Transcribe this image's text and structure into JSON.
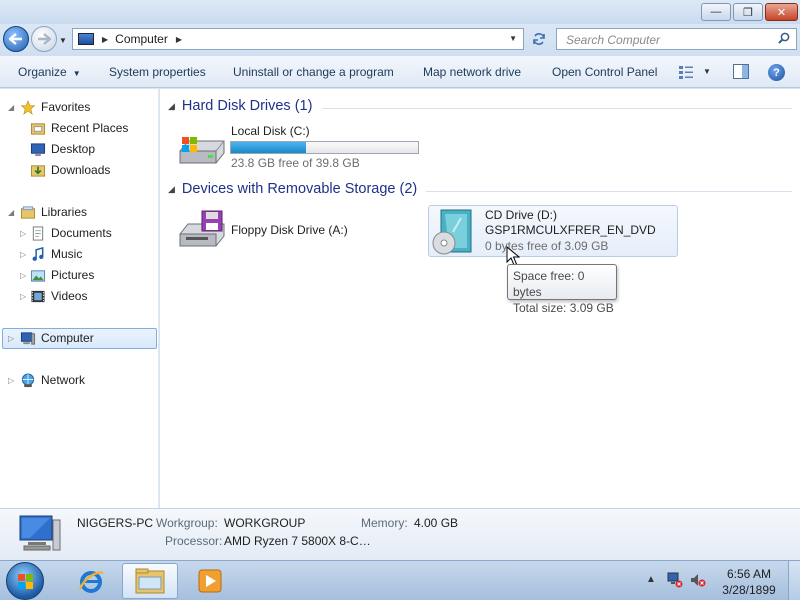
{
  "window": {
    "min_label": "—",
    "max_label": "❐",
    "close_label": "✕"
  },
  "nav": {
    "back_icon": "back-arrow-icon",
    "forward_icon": "forward-arrow-icon",
    "address": {
      "segments": [
        "Computer"
      ],
      "icon": "computer-icon"
    },
    "search": {
      "placeholder": "Search Computer"
    }
  },
  "commands": {
    "organize": "Organize",
    "system_properties": "System properties",
    "uninstall": "Uninstall or change a program",
    "map_network": "Map network drive",
    "open_control_panel": "Open Control Panel"
  },
  "sidebar": {
    "favorites": {
      "label": "Favorites",
      "items": [
        {
          "label": "Recent Places",
          "icon": "recent-places-icon"
        },
        {
          "label": "Desktop",
          "icon": "desktop-icon"
        },
        {
          "label": "Downloads",
          "icon": "downloads-icon"
        }
      ]
    },
    "libraries": {
      "label": "Libraries",
      "items": [
        {
          "label": "Documents",
          "icon": "documents-icon"
        },
        {
          "label": "Music",
          "icon": "music-icon"
        },
        {
          "label": "Pictures",
          "icon": "pictures-icon"
        },
        {
          "label": "Videos",
          "icon": "videos-icon"
        }
      ]
    },
    "computer": {
      "label": "Computer",
      "selected": true
    },
    "network": {
      "label": "Network"
    }
  },
  "content": {
    "groups": [
      {
        "title": "Hard Disk Drives (1)",
        "drives": [
          {
            "name": "Local Disk (C:)",
            "free_text": "23.8 GB free of 39.8 GB",
            "used_fraction": 0.402,
            "bar_color": "#26a0da"
          }
        ]
      },
      {
        "title": "Devices with Removable Storage (2)",
        "drives": [
          {
            "name": "Floppy Disk Drive (A:)"
          },
          {
            "name": "CD Drive (D:)",
            "label": "GSP1RMCULXFRER_EN_DVD",
            "free_text": "0 bytes free of 3.09 GB"
          }
        ]
      }
    ],
    "tooltip": {
      "line1": "Space free: 0 bytes",
      "line2": "Total size: 3.09 GB"
    }
  },
  "details": {
    "computer_name": "NIGGERS-PC",
    "workgroup_label": "Workgroup:",
    "workgroup_value": "WORKGROUP",
    "memory_label": "Memory:",
    "memory_value": "4.00 GB",
    "processor_label": "Processor:",
    "processor_value": "AMD Ryzen 7 5800X 8-C…"
  },
  "taskbar": {
    "items": [
      "start-orb",
      "internet-explorer-icon",
      "windows-explorer-icon",
      "media-player-icon"
    ],
    "clock_time": "6:56 AM",
    "clock_date": "3/28/1899"
  }
}
